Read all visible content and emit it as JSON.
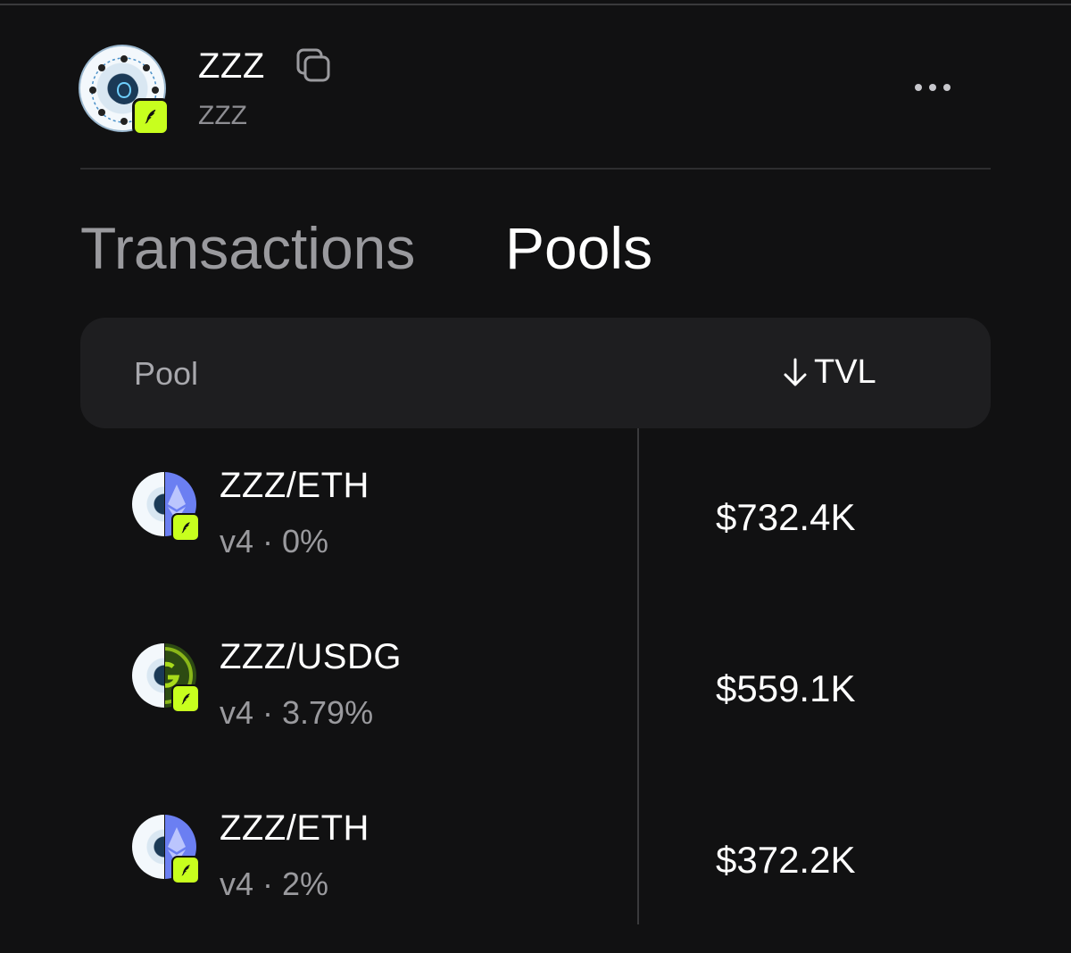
{
  "token": {
    "name": "ZZZ",
    "symbol": "ZZZ",
    "avatar_icon": "brain-network-icon",
    "badge_icon": "quill-badge-icon",
    "badge_color": "#c8ff1e"
  },
  "tabs": [
    {
      "label": "Transactions",
      "active": false
    },
    {
      "label": "Pools",
      "active": true
    }
  ],
  "table": {
    "columns": {
      "pool": "Pool",
      "tvl": "TVL",
      "sort_icon": "arrow-down-icon"
    },
    "rows": [
      {
        "pair": "ZZZ/ETH",
        "meta": "v4 · 0%",
        "tvl": "$732.4K",
        "quote_icon": "eth-icon"
      },
      {
        "pair": "ZZZ/USDG",
        "meta": "v4 · 3.79%",
        "tvl": "$559.1K",
        "quote_icon": "usdg-icon"
      },
      {
        "pair": "ZZZ/ETH",
        "meta": "v4 · 2%",
        "tvl": "$372.2K",
        "quote_icon": "eth-icon"
      }
    ]
  },
  "colors": {
    "background": "#111112",
    "header_bg": "#1e1e20",
    "eth": "#6b7ff2",
    "usdg": "#2d4b12"
  }
}
